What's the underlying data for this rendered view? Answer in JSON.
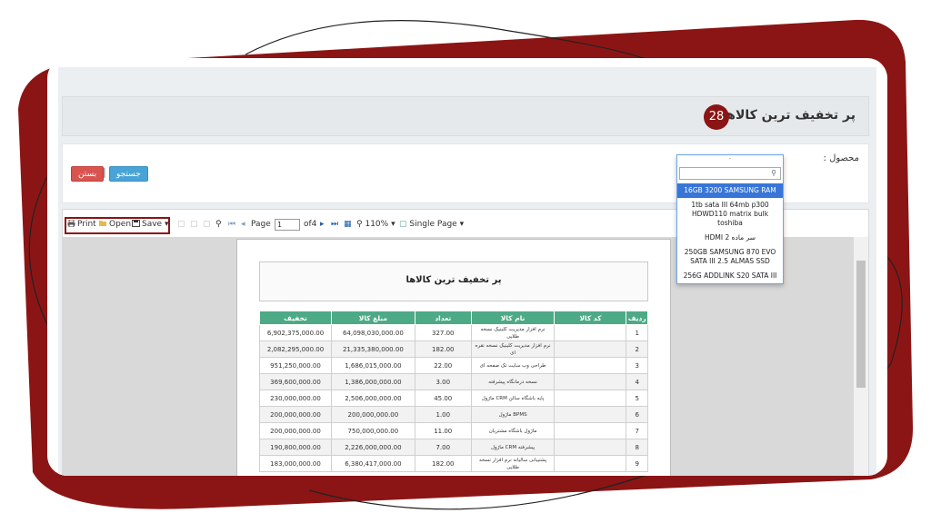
{
  "page": {
    "title": "پر تخفیف ترین کالاها",
    "badge": "28"
  },
  "filter": {
    "product_label": "محصول :",
    "search_button": "جستجو",
    "close_button": "بستن",
    "separator": "|"
  },
  "toolbar": {
    "print": "Print",
    "open": "Open",
    "save": "Save",
    "page_label": "Page",
    "page_value": "1",
    "page_of": "of4",
    "zoom": "110%",
    "view_mode": "Single Page"
  },
  "report": {
    "title": "پر تخفیف ترین کالاها",
    "columns": [
      "ردیف",
      "کد کالا",
      "نام کالا",
      "تعداد",
      "مبلغ کالا",
      "تخفیف"
    ],
    "rows": [
      {
        "row": "1",
        "code": "",
        "name": "نرم افزار مدیریت کلینیک نسخه طلایی",
        "qty": "327.00",
        "amount": "64,098,030,000.00",
        "discount": "6,902,375,000.00"
      },
      {
        "row": "2",
        "code": "",
        "name": "نرم افزار مدیریت کلینیک نسخه نقره ای",
        "qty": "182.00",
        "amount": "21,335,380,000.00",
        "discount": "2,082,295,000.00"
      },
      {
        "row": "3",
        "code": "",
        "name": "طراحی وب سایت تک صفحه ای",
        "qty": "22.00",
        "amount": "1,686,015,000.00",
        "discount": "951,250,000.00"
      },
      {
        "row": "4",
        "code": "",
        "name": "نسخه درمانگاه پیشرفته",
        "qty": "3.00",
        "amount": "1,386,000,000.00",
        "discount": "369,600,000.00"
      },
      {
        "row": "5",
        "code": "",
        "name": "پایه باشگاه سالن CRM ماژول",
        "qty": "45.00",
        "amount": "2,506,000,000.00",
        "discount": "230,000,000.00"
      },
      {
        "row": "6",
        "code": "",
        "name": "BPMS ماژول",
        "qty": "1.00",
        "amount": "200,000,000.00",
        "discount": "200,000,000.00"
      },
      {
        "row": "7",
        "code": "",
        "name": "ماژول باشگاه مشتریان",
        "qty": "11.00",
        "amount": "750,000,000.00",
        "discount": "200,000,000.00"
      },
      {
        "row": "8",
        "code": "",
        "name": "پیشرفته CRM ماژول",
        "qty": "7.00",
        "amount": "2,226,000,000.00",
        "discount": "190,800,000.00"
      },
      {
        "row": "9",
        "code": "",
        "name": "پشتیبانی سالیانه نرم افزار نسخه طلایی",
        "qty": "182.00",
        "amount": "6,380,417,000.00",
        "discount": "183,000,000.00"
      }
    ]
  },
  "dropdown": {
    "header": "-",
    "items": [
      "16GB 3200 SAMSUNG RAM",
      "1tb sata III 64mb p300 HDWD110 matrix bulk toshiba",
      "HDMI 2 سر ماده",
      "250GB SAMSUNG 870 EVO SATA III 2.5 ALMAS SSD",
      "256G ADDLINK S20 SATA III"
    ]
  },
  "colors": {
    "accent_dark_red": "#8b1515",
    "table_header": "#4daa86",
    "search_button": "#4aa3d6",
    "close_button": "#d9534f",
    "selected_item": "#3875d7"
  }
}
